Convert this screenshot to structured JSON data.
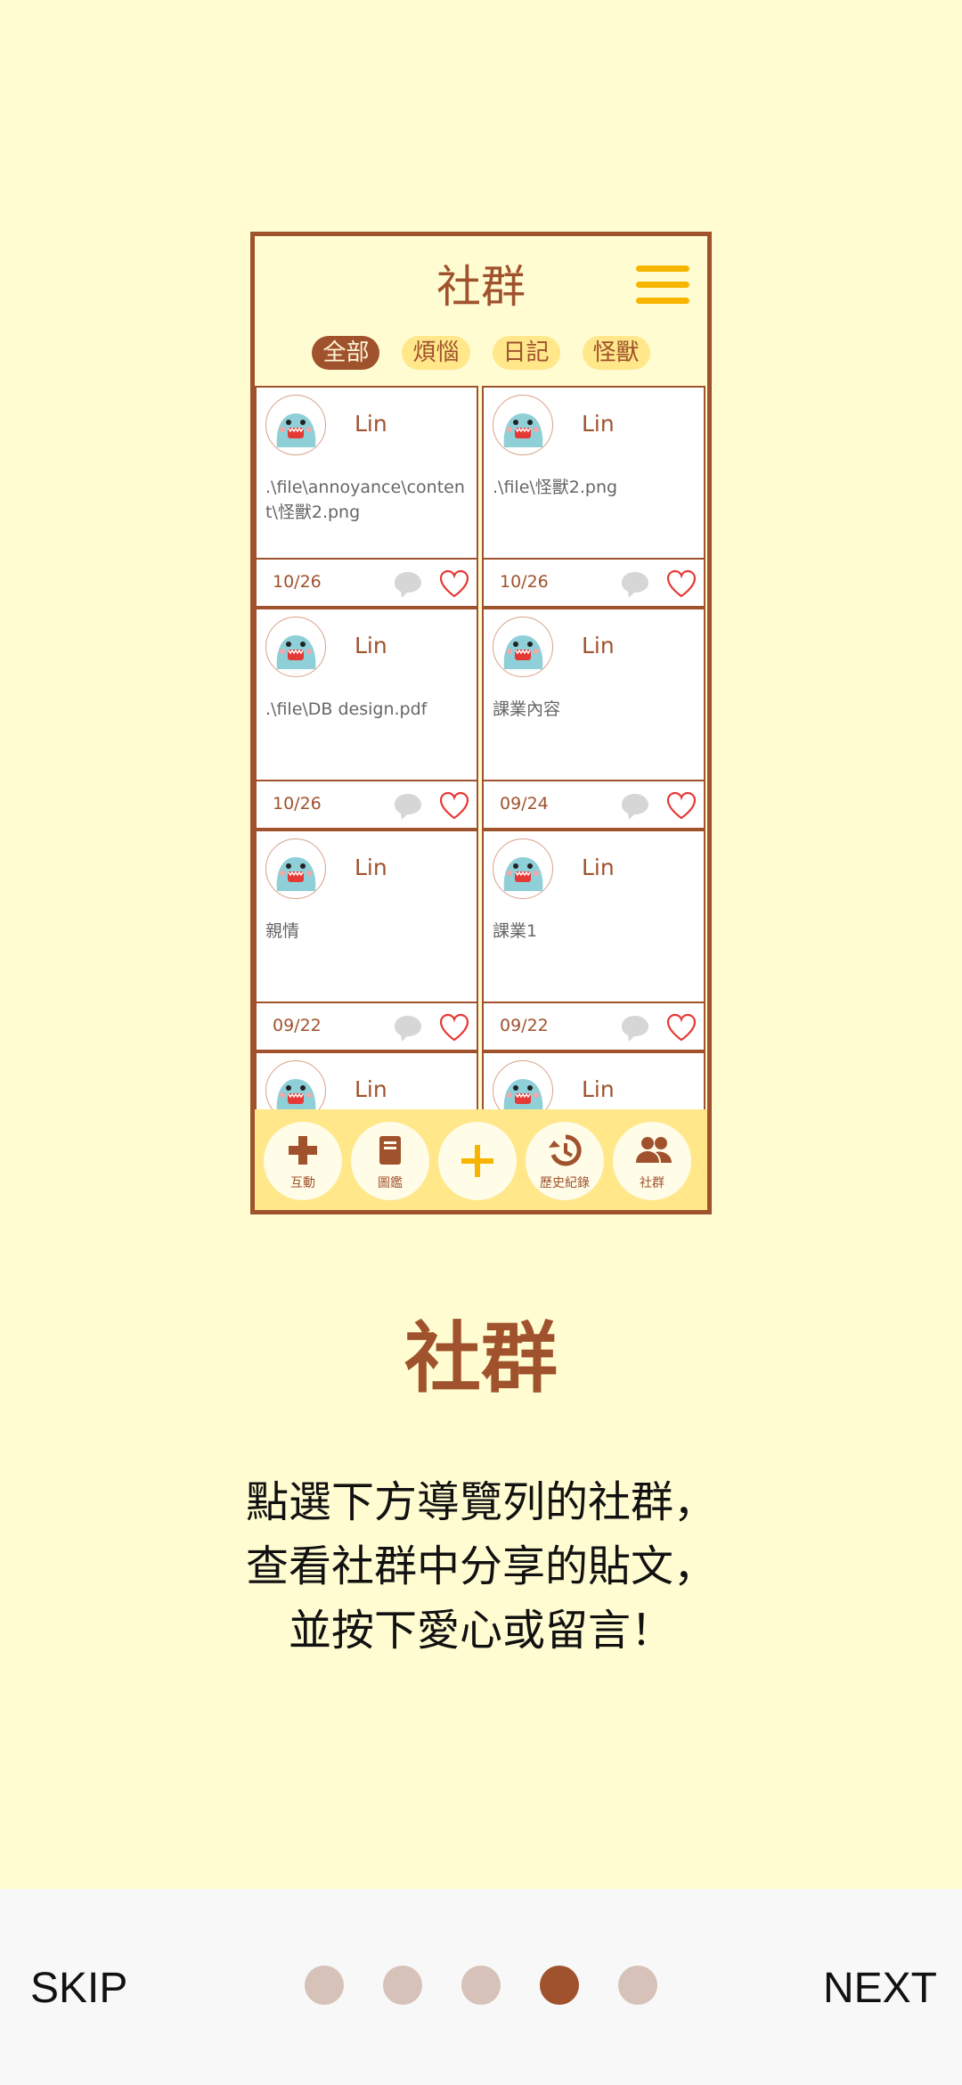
{
  "mock": {
    "title": "社群",
    "filters": [
      "全部",
      "煩惱",
      "日記",
      "怪獸"
    ],
    "posts": [
      {
        "user": "Lin",
        "content": ".\\file\\annoyance\\content\\怪獸2.png",
        "date": "10/26"
      },
      {
        "user": "Lin",
        "content": ".\\file\\怪獸2.png",
        "date": "10/26"
      },
      {
        "user": "Lin",
        "content": ".\\file\\DB design.pdf",
        "date": "10/26"
      },
      {
        "user": "Lin",
        "content": "課業內容",
        "date": "09/24"
      },
      {
        "user": "Lin",
        "content": "親情",
        "date": "09/22"
      },
      {
        "user": "Lin",
        "content": "課業1",
        "date": "09/22"
      },
      {
        "user": "Lin",
        "content": "",
        "date": ""
      },
      {
        "user": "Lin",
        "content": "",
        "date": ""
      }
    ],
    "nav": [
      {
        "label": "互動",
        "icon": "gamepad-icon"
      },
      {
        "label": "圖鑑",
        "icon": "book-icon"
      },
      {
        "label": "",
        "icon": "plus-icon"
      },
      {
        "label": "歷史紀錄",
        "icon": "history-icon"
      },
      {
        "label": "社群",
        "icon": "people-icon"
      }
    ]
  },
  "title": "社群",
  "description": [
    "點選下方導覽列的社群，",
    "查看社群中分享的貼文，",
    "並按下愛心或留言！"
  ],
  "footer": {
    "skip": "SKIP",
    "next": "NEXT",
    "dots": 5,
    "active_index": 3
  },
  "colors": {
    "brand": "#A0522D",
    "accent": "#F7B500",
    "background": "#FFFCD1"
  }
}
